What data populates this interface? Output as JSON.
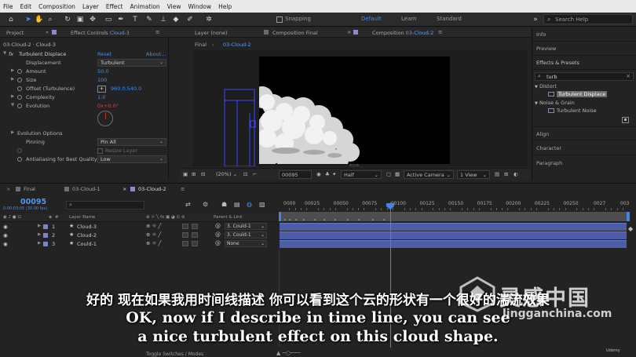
{
  "menu": [
    "File",
    "Edit",
    "Composition",
    "Layer",
    "Effect",
    "Animation",
    "View",
    "Window",
    "Help"
  ],
  "toolbar": {
    "snapping": "Snapping",
    "workspaces": [
      "Default",
      "Learn",
      "Standard"
    ],
    "search_placeholder": "Search Help",
    "accent": "#3d8ef0"
  },
  "left_tabs": {
    "project": "Project",
    "effect_controls_prefix": "Effect Controls",
    "effect_controls_layer": "Cloud-3"
  },
  "effect_controls": {
    "breadcrumb": "03-Cloud-2 · Cloud-3",
    "effect_name": "Turbulent Displace",
    "reset": "Reset",
    "about": "About...",
    "properties": [
      {
        "label": "Displacement",
        "value": "Turbulent",
        "kind": "dropdown"
      },
      {
        "label": "Amount",
        "value": "50.0",
        "kind": "value"
      },
      {
        "label": "Size",
        "value": "100",
        "kind": "value"
      },
      {
        "label": "Offset (Turbulence)",
        "value": "960.0,540.0",
        "kind": "point"
      },
      {
        "label": "Complexity",
        "value": "1.0",
        "kind": "value"
      },
      {
        "label": "Evolution",
        "value": "0x+0.0°",
        "kind": "angle"
      }
    ],
    "evolution_options": "Evolution Options",
    "pinning_label": "Pinning",
    "pinning_value": "Pin All",
    "resize_layer": "Resize Layer",
    "antialiasing_label": "Antialiasing for Best Quality",
    "antialiasing_value": "Low"
  },
  "viewer_tabs": {
    "layer": "Layer (none)",
    "comp_final": "Composition Final",
    "comp_active_prefix": "Composition",
    "comp_active_name": "03-Cloud-2",
    "breadcrumb_a": "Final",
    "breadcrumb_b": "03-Cloud-2"
  },
  "viewer_bottom": {
    "zoom": "(20%)",
    "timecode": "00095",
    "resolution": "Half",
    "camera": "Active Camera",
    "views": "1 View"
  },
  "right_panels": {
    "info": "Info",
    "preview": "Preview",
    "effects_presets": "Effects & Presets",
    "search_value": "turb",
    "categories": [
      {
        "name": "Distort",
        "items": [
          "Turbulent Displace"
        ]
      },
      {
        "name": "Noise & Grain",
        "items": [
          "Turbulent Noise"
        ]
      }
    ],
    "align": "Align",
    "character": "Character",
    "paragraph": "Paragraph"
  },
  "timeline": {
    "tabs": [
      {
        "label": "Final",
        "color": "#a0a0a0"
      },
      {
        "label": "03-Cloud-1",
        "color": "#a0a0a0"
      },
      {
        "label": "03-Cloud-2",
        "color": "#a0a0a0"
      }
    ],
    "timecode": "00095",
    "frame_info": "0:00:03:05 (30.00 fps)",
    "col_layer_name": "Layer Name",
    "col_parent": "Parent & Link",
    "layers": [
      {
        "num": "1",
        "name": "Cloud-3",
        "parent": "3. Could-1"
      },
      {
        "num": "2",
        "name": "Cloud-2",
        "parent": "3. Could-1"
      },
      {
        "num": "3",
        "name": "Could-1",
        "parent": "None"
      }
    ],
    "ruler_labels": [
      "0000",
      "00025",
      "00050",
      "00075",
      "00100",
      "00125",
      "00150",
      "00175",
      "00200",
      "00225",
      "00250",
      "0027"
    ],
    "ruler_end": "003",
    "toggle_switches": "Toggle Switches / Modes",
    "playhead_frame": 95,
    "ruler_max": 300,
    "layer_color": "#4e5da8"
  },
  "subtitles": {
    "cn": "好的 现在如果我用时间线描述 你可以看到这个云的形状有一个很好的湍流效果",
    "en_line1": "OK, now if I describe in time line, you can see",
    "en_line2": "a nice turbulent effect on this cloud shape."
  },
  "watermark": {
    "cn": "灵感中国",
    "en": "lingganchina.com",
    "udemy": "Udemy"
  }
}
